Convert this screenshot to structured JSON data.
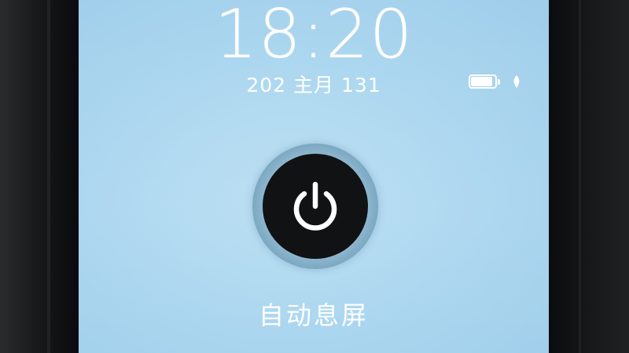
{
  "lock_screen": {
    "time": "18:20",
    "date": "202 主月 131"
  },
  "status": {
    "battery_level": 0.9,
    "battery_icon": "battery-icon",
    "leaf_icon": "leaf-icon"
  },
  "power_control": {
    "icon": "power-icon",
    "label": "自动息屏"
  },
  "colors": {
    "screen_background": "#acd7f0",
    "button_fill": "#101214",
    "text": "#ffffff"
  }
}
